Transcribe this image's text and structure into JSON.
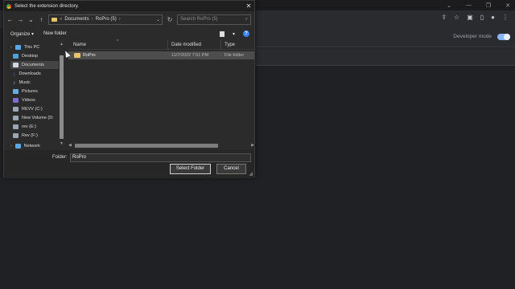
{
  "browser": {
    "developer_mode_label": "Developer mode",
    "developer_mode_on": true
  },
  "dialog": {
    "title": "Select the extension directory.",
    "breadcrumb": [
      "Documents",
      "RoPro (5)"
    ],
    "search_placeholder": "Search RoPro (5)",
    "organize_label": "Organize",
    "new_folder_label": "New folder",
    "nav_items": [
      {
        "label": "This PC",
        "icon": "pc-icon"
      },
      {
        "label": "Desktop",
        "icon": "desktop-icon"
      },
      {
        "label": "Documents",
        "icon": "documents-icon",
        "selected": true
      },
      {
        "label": "Downloads",
        "icon": "download-icon"
      },
      {
        "label": "Music",
        "icon": "music-icon"
      },
      {
        "label": "Pictures",
        "icon": "pictures-icon"
      },
      {
        "label": "Videos",
        "icon": "videos-icon"
      },
      {
        "label": "REVV (C:)",
        "icon": "drive-icon"
      },
      {
        "label": "New Volume (D:",
        "icon": "drive-icon"
      },
      {
        "label": "rev (E:)",
        "icon": "drive-icon"
      },
      {
        "label": "Rev (F:)",
        "icon": "drive-icon"
      },
      {
        "label": "Network",
        "icon": "network-icon"
      }
    ],
    "columns": {
      "name": "Name",
      "date": "Date modified",
      "type": "Type"
    },
    "files": [
      {
        "name": "RoPro",
        "date": "11/7/2022 7:51 PM",
        "type": "File folder"
      }
    ],
    "folder_label": "Folder:",
    "folder_value": "RoPro",
    "select_button": "Select Folder",
    "cancel_button": "Cancel"
  }
}
